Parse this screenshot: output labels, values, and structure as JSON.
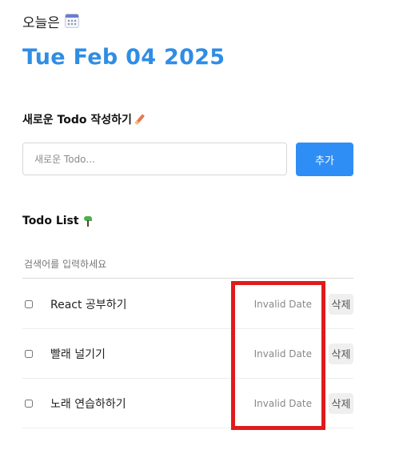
{
  "header": {
    "today_label": "오늘은",
    "calendar_icon": "calendar-icon"
  },
  "date": {
    "display": "Tue Feb 04 2025"
  },
  "new_todo": {
    "title": "새로운 Todo 작성하기",
    "title_icon": "pencil-icon",
    "input_placeholder": "새로운 Todo...",
    "add_button_label": "추가"
  },
  "todo_list": {
    "title": "Todo List",
    "title_icon": "sprout-icon",
    "search_placeholder": "검색어를 입력하세요",
    "items": [
      {
        "text": "React 공부하기",
        "date": "Invalid Date",
        "delete_label": "삭제",
        "checked": false
      },
      {
        "text": "빨래 널기기",
        "date": "Invalid Date",
        "delete_label": "삭제",
        "checked": false
      },
      {
        "text": "노래 연습하하기",
        "date": "Invalid Date",
        "delete_label": "삭제",
        "checked": false
      }
    ]
  },
  "colors": {
    "accent": "#2f8de4",
    "button": "#2f8ef6",
    "highlight": "#e01b1b"
  }
}
